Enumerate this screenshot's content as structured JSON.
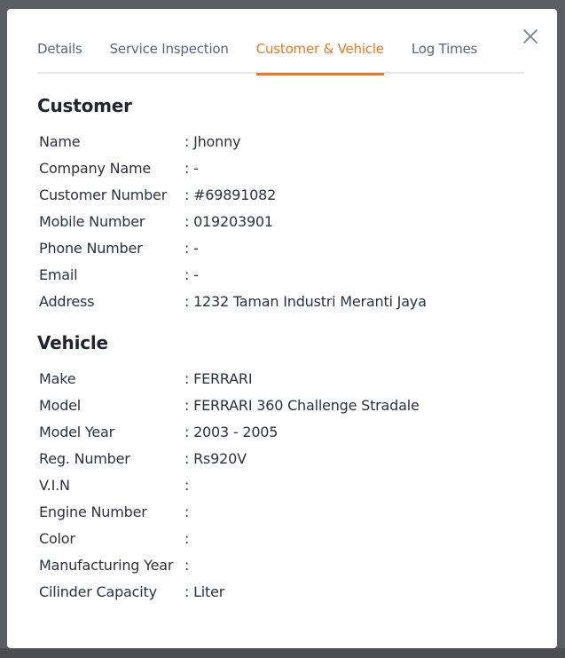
{
  "tabs": [
    {
      "label": "Details"
    },
    {
      "label": "Service Inspection"
    },
    {
      "label": "Customer & Vehicle"
    },
    {
      "label": "Log Times"
    }
  ],
  "active_tab": "Customer & Vehicle",
  "close_icon": "close-icon",
  "customer": {
    "title": "Customer",
    "fields": [
      {
        "label": "Name",
        "value": ": Jhonny"
      },
      {
        "label": "Company Name",
        "value": ": -"
      },
      {
        "label": "Customer Number",
        "value": ": #69891082"
      },
      {
        "label": "Mobile Number",
        "value": ": 019203901"
      },
      {
        "label": "Phone Number",
        "value": ": -"
      },
      {
        "label": "Email",
        "value": ": -"
      },
      {
        "label": "Address",
        "value": ": 1232 Taman Industri Meranti Jaya"
      }
    ]
  },
  "vehicle": {
    "title": "Vehicle",
    "fields": [
      {
        "label": "Make",
        "value": ": FERRARI"
      },
      {
        "label": "Model",
        "value": ": FERRARI 360 Challenge Stradale"
      },
      {
        "label": "Model Year",
        "value": ": 2003 - 2005"
      },
      {
        "label": "Reg. Number",
        "value": ": Rs920V"
      },
      {
        "label": "V.I.N",
        "value": ":"
      },
      {
        "label": "Engine Number",
        "value": ":"
      },
      {
        "label": "Color",
        "value": ":"
      },
      {
        "label": "Manufacturing Year",
        "value": ":"
      },
      {
        "label": "Cilinder Capacity",
        "value": ": Liter"
      }
    ]
  },
  "colors": {
    "accent": "#ec7a1c",
    "text": "#2a3140",
    "tab_inactive": "#5b6573",
    "overlay": "#5a5d62"
  }
}
